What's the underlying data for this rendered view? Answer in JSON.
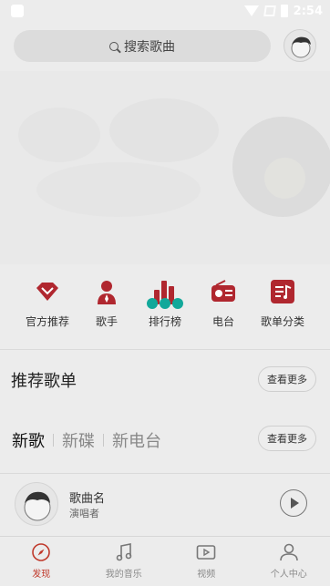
{
  "statusbar": {
    "time": "2:54"
  },
  "search": {
    "placeholder": "搜索歌曲"
  },
  "quick_icons": [
    {
      "label": "官方推荐",
      "icon": "gem-icon"
    },
    {
      "label": "歌手",
      "icon": "singer-icon"
    },
    {
      "label": "排行榜",
      "icon": "chart-icon"
    },
    {
      "label": "电台",
      "icon": "radio-icon"
    },
    {
      "label": "歌单分类",
      "icon": "playlist-category-icon"
    }
  ],
  "recommend": {
    "title": "推荐歌单",
    "more": "查看更多"
  },
  "tabs": {
    "items": [
      "新歌",
      "新碟",
      "新电台"
    ],
    "active": 0,
    "more": "查看更多"
  },
  "song": {
    "name": "歌曲名",
    "artist": "演唱者"
  },
  "bottom_nav": [
    {
      "label": "发现",
      "icon": "compass-icon",
      "active": true
    },
    {
      "label": "我的音乐",
      "icon": "music-note-icon",
      "active": false
    },
    {
      "label": "视频",
      "icon": "video-icon",
      "active": false
    },
    {
      "label": "个人中心",
      "icon": "user-icon",
      "active": false
    }
  ],
  "colors": {
    "accent": "#c0392b",
    "loading": "#12a89a"
  }
}
